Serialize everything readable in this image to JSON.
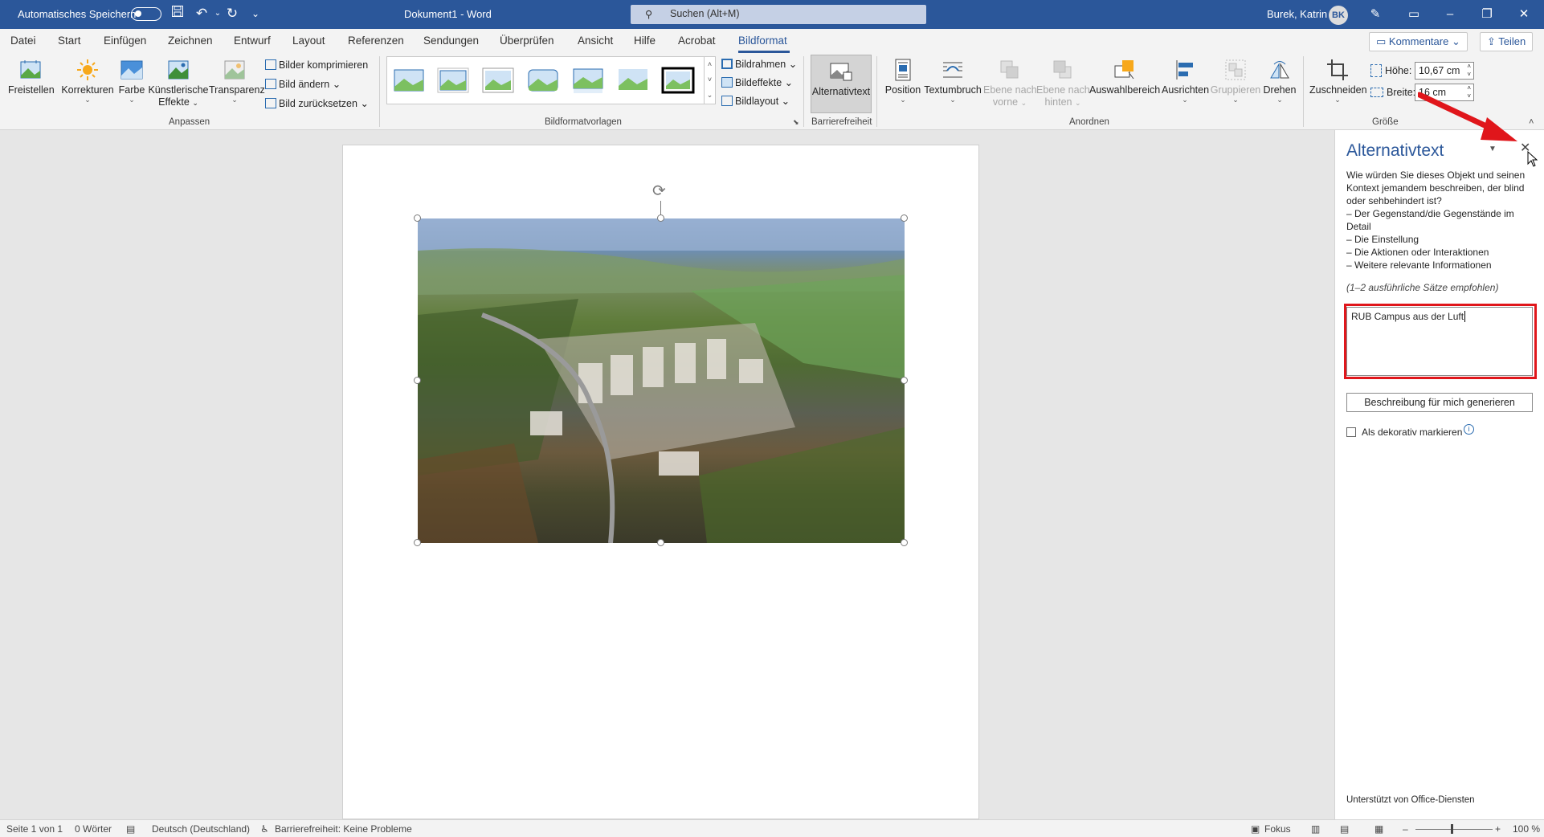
{
  "titlebar": {
    "autosave_label": "Automatisches Speichern",
    "doc_title": "Dokument1  -  Word",
    "search_placeholder": "Suchen (Alt+M)",
    "user_name": "Burek, Katrin",
    "user_initials": "BK",
    "qa_save_icon": "save-icon",
    "qa_undo_icon": "undo-icon",
    "qa_redo_icon": "redo-icon"
  },
  "tabs": [
    {
      "label": "Datei"
    },
    {
      "label": "Start"
    },
    {
      "label": "Einfügen"
    },
    {
      "label": "Zeichnen"
    },
    {
      "label": "Entwurf"
    },
    {
      "label": "Layout"
    },
    {
      "label": "Referenzen"
    },
    {
      "label": "Sendungen"
    },
    {
      "label": "Überprüfen"
    },
    {
      "label": "Ansicht"
    },
    {
      "label": "Hilfe"
    },
    {
      "label": "Acrobat"
    },
    {
      "label": "Bildformat"
    }
  ],
  "active_tab": "Bildformat",
  "tab_buttons": {
    "comments": "Kommentare",
    "share": "Teilen"
  },
  "ribbon": {
    "anpassen": {
      "label": "Anpassen",
      "freistellen": "Freistellen",
      "korrekturen": "Korrekturen",
      "farbe": "Farbe",
      "kuenstlerisch_1": "Künstlerische",
      "kuenstlerisch_2": "Effekte",
      "transparenz": "Transparenz",
      "komprimieren": "Bilder komprimieren",
      "aendern": "Bild ändern",
      "zuruecksetzen": "Bild zurücksetzen"
    },
    "vorlagen": {
      "label": "Bildformatvorlagen",
      "bildrahmen": "Bildrahmen",
      "bildeffekte": "Bildeffekte",
      "bildlayout": "Bildlayout"
    },
    "barriere": {
      "label": "Barrierefreiheit",
      "alttext": "Alternativtext"
    },
    "anordnen": {
      "label": "Anordnen",
      "position": "Position",
      "textumbruch": "Textumbruch",
      "ebene_vorne_1": "Ebene nach",
      "ebene_vorne_2": "vorne",
      "ebene_hinten_1": "Ebene nach",
      "ebene_hinten_2": "hinten",
      "auswahlbereich": "Auswahlbereich",
      "ausrichten": "Ausrichten",
      "gruppieren": "Gruppieren",
      "drehen": "Drehen"
    },
    "groesse": {
      "label": "Größe",
      "zuschneiden": "Zuschneiden",
      "hoehe_label": "Höhe:",
      "hoehe_value": "10,67 cm",
      "breite_label": "Breite:",
      "breite_value": "16 cm"
    }
  },
  "pane": {
    "title": "Alternativtext",
    "desc": [
      "Wie würden Sie dieses Objekt und seinen",
      "Kontext jemandem beschreiben, der blind",
      "oder sehbehindert ist?",
      "– Der Gegenstand/die Gegenstände im",
      "Detail",
      "– Die Einstellung",
      "– Die Aktionen oder Interaktionen",
      "– Weitere relevante Informationen"
    ],
    "hint": "(1–2 ausführliche Sätze empfohlen)",
    "alt_value": "RUB Campus aus der Luft",
    "generate": "Beschreibung für mich generieren",
    "decorative": "Als dekorativ markieren",
    "footer": "Unterstützt von Office-Diensten"
  },
  "status": {
    "page": "Seite 1 von 1",
    "words": "0 Wörter",
    "language": "Deutsch (Deutschland)",
    "accessibility": "Barrierefreiheit: Keine Probleme",
    "focus": "Fokus",
    "zoom": "100 %"
  },
  "colors": {
    "word_blue": "#2b579a",
    "annotation_red": "#e0161b"
  }
}
